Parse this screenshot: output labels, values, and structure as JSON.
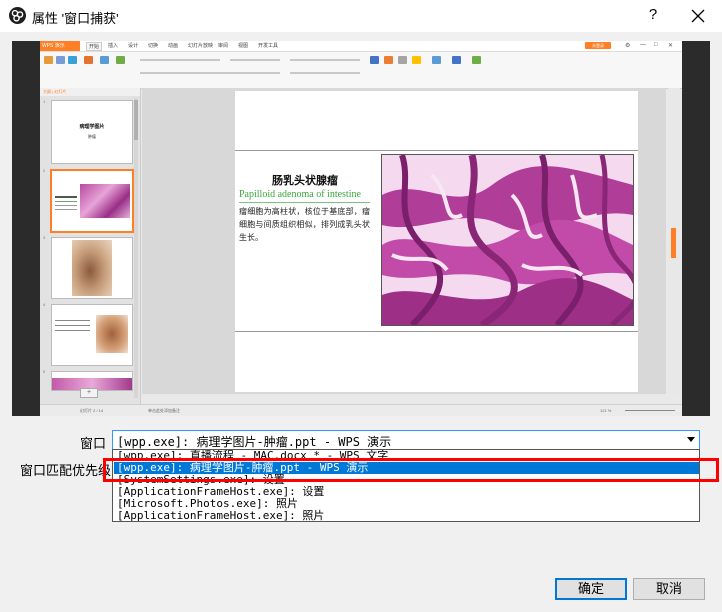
{
  "window": {
    "title": "属性 '窗口捕获'",
    "help_label": "?",
    "icon": "obs-logo-icon",
    "close_icon": "close-icon"
  },
  "preview": {
    "app": {
      "brand": "WPS 演示",
      "tabs": [
        "开始",
        "插入",
        "设计",
        "切换",
        "动画",
        "幻灯片放映",
        "审阅",
        "视图",
        "开发工具"
      ],
      "active_tab": "开始",
      "login_label": "未登录",
      "pane_label": "大纲 | 幻灯片",
      "thumb_numbers": [
        "1",
        "2",
        "3",
        "4",
        "5"
      ],
      "status_left": "幻灯片 2 / 14",
      "status_mid": "单击此处添加备注",
      "status_zoom": "121 %"
    },
    "slide": {
      "title_cn": "肠乳头状腺瘤",
      "title_en": "Papilloid adenoma of intestine",
      "body": "瘤细胞为高柱状，核位于基底部，瘤细胞与间质组织相似，排列成乳头状生长。",
      "thumb1_title": "病理学图片",
      "thumb1_sub": "肿瘤"
    },
    "accent_color": "#ff7f27"
  },
  "form": {
    "window_label": "窗口",
    "priority_label": "窗口匹配优先级",
    "window_value": "[wpp.exe]: 病理学图片-肿瘤.ppt - WPS 演示",
    "options": [
      "[wpp.exe]: 直播流程 - MAC.docx * - WPS 文字",
      "[wpp.exe]: 病理学图片-肿瘤.ppt - WPS 演示",
      "[SystemSettings.exe]: 设置",
      "[ApplicationFrameHost.exe]: 设置",
      "[Microsoft.Photos.exe]: 照片",
      "[ApplicationFrameHost.exe]: 照片"
    ],
    "selected_option": "[wpp.exe]: 病理学图片-肿瘤.ppt - WPS 演示",
    "highlight_color": "#ff0000",
    "selection_color": "#0078d7"
  },
  "buttons": {
    "ok": "确定",
    "cancel": "取消"
  }
}
